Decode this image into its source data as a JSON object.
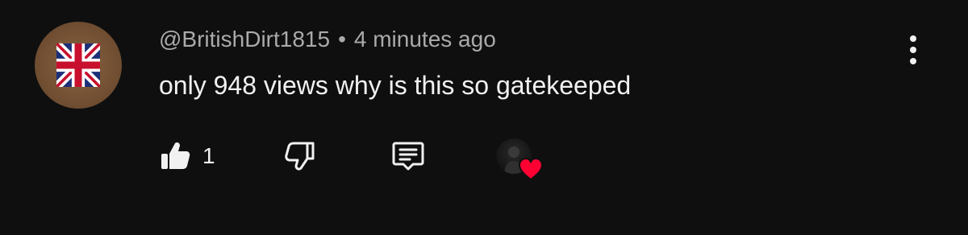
{
  "comment": {
    "author_handle": "@BritishDirt1815",
    "separator": "•",
    "timestamp": "4 minutes ago",
    "text": "only 948 views why is this so gatekeeped",
    "like_count": "1"
  },
  "icons": {
    "avatar": "union-jack-avatar",
    "menu": "more-vert-icon",
    "like": "thumbs-up-icon",
    "dislike": "thumbs-down-icon",
    "reply": "reply-comment-icon",
    "hearted": "creator-heart-icon"
  },
  "colors": {
    "background": "#0f0f0f",
    "text_primary": "#f1f1f1",
    "text_secondary": "#aaaaaa",
    "heart": "#ff0033",
    "flag_blue": "#1b2f78",
    "flag_red": "#c8102e"
  }
}
